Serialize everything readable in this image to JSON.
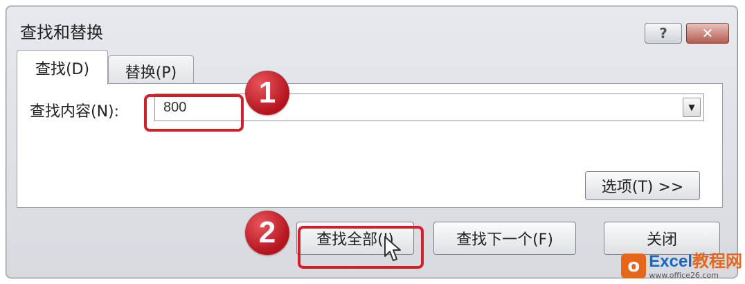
{
  "dialog": {
    "title": "查找和替换",
    "help_button": "?",
    "close_button": "✕"
  },
  "tabs": [
    {
      "label": "查找(D)",
      "active": true
    },
    {
      "label": "替换(P)",
      "active": false
    }
  ],
  "find": {
    "label": "查找内容(N):",
    "value": "800"
  },
  "buttons": {
    "options": "选项(T) >>",
    "find_all": "查找全部(I)",
    "find_next": "查找下一个(F)",
    "close": "关闭"
  },
  "steps": [
    "1",
    "2"
  ],
  "watermark": {
    "logo": "o",
    "brand_en": "Excel",
    "brand_cn": "教程网",
    "url": "www.office26.com"
  },
  "colors": {
    "highlight": "#d11f2c",
    "badge": "#b3141d"
  }
}
